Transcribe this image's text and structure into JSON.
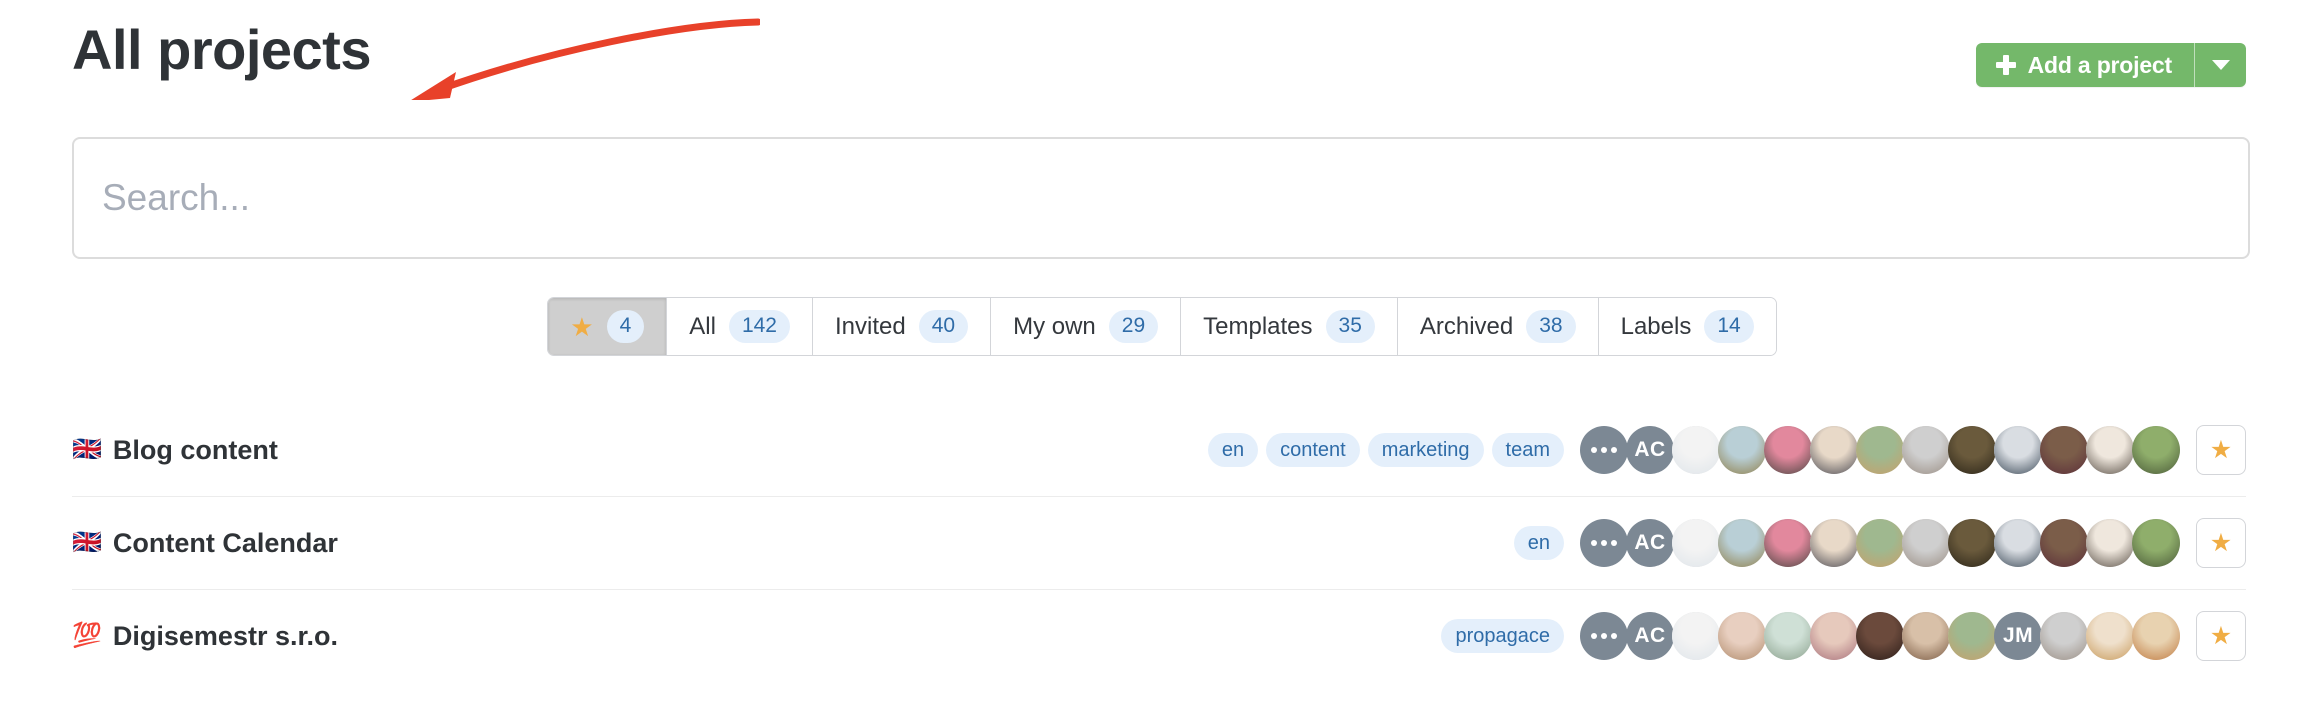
{
  "header": {
    "title": "All projects",
    "add_project_label": "Add a project"
  },
  "search": {
    "placeholder": "Search...",
    "value": ""
  },
  "tabs": [
    {
      "label": "",
      "icon": "star-icon",
      "count": "4",
      "active": true
    },
    {
      "label": "All",
      "count": "142",
      "active": false
    },
    {
      "label": "Invited",
      "count": "40",
      "active": false
    },
    {
      "label": "My own",
      "count": "29",
      "active": false
    },
    {
      "label": "Templates",
      "count": "35",
      "active": false
    },
    {
      "label": "Archived",
      "count": "38",
      "active": false
    },
    {
      "label": "Labels",
      "count": "14",
      "active": false
    }
  ],
  "projects": [
    {
      "emoji": "🇬🇧",
      "name": "Blog content",
      "tags": [
        "en",
        "content",
        "marketing",
        "team"
      ],
      "avatars": [
        {
          "type": "dots"
        },
        {
          "type": "initials",
          "text": "AC"
        },
        {
          "type": "photo",
          "color1": "#f3f3f3",
          "color2": "#dfe5ea"
        },
        {
          "type": "photo",
          "color1": "#b9cfd6",
          "color2": "#8f7f4a"
        },
        {
          "type": "photo",
          "color1": "#e2889d",
          "color2": "#4a4440"
        },
        {
          "type": "photo",
          "color1": "#e8d9c8",
          "color2": "#4b4a52"
        },
        {
          "type": "photo",
          "color1": "#9fb88f",
          "color2": "#c8a06a"
        },
        {
          "type": "photo",
          "color1": "#cfcfcf",
          "color2": "#9a8e84"
        },
        {
          "type": "photo",
          "color1": "#6a5a3c",
          "color2": "#2a2418"
        },
        {
          "type": "photo",
          "color1": "#d9dde2",
          "color2": "#3c4a58"
        },
        {
          "type": "photo",
          "color1": "#7b5d49",
          "color2": "#5b2e39"
        },
        {
          "type": "photo",
          "color1": "#efe7dd",
          "color2": "#5a5148"
        },
        {
          "type": "photo",
          "color1": "#8fae6b",
          "color2": "#4a5a38"
        }
      ],
      "starred": true
    },
    {
      "emoji": "🇬🇧",
      "name": "Content Calendar",
      "tags": [
        "en"
      ],
      "avatars": [
        {
          "type": "dots"
        },
        {
          "type": "initials",
          "text": "AC"
        },
        {
          "type": "photo",
          "color1": "#f3f3f3",
          "color2": "#dfe5ea"
        },
        {
          "type": "photo",
          "color1": "#b9cfd6",
          "color2": "#8f7f4a"
        },
        {
          "type": "photo",
          "color1": "#e2889d",
          "color2": "#4a4440"
        },
        {
          "type": "photo",
          "color1": "#e8d9c8",
          "color2": "#4b4a52"
        },
        {
          "type": "photo",
          "color1": "#9fb88f",
          "color2": "#c8a06a"
        },
        {
          "type": "photo",
          "color1": "#cfcfcf",
          "color2": "#9a8e84"
        },
        {
          "type": "photo",
          "color1": "#6a5a3c",
          "color2": "#2a2418"
        },
        {
          "type": "photo",
          "color1": "#d9dde2",
          "color2": "#3c4a58"
        },
        {
          "type": "photo",
          "color1": "#7b5d49",
          "color2": "#5b2e39"
        },
        {
          "type": "photo",
          "color1": "#efe7dd",
          "color2": "#5a5148"
        },
        {
          "type": "photo",
          "color1": "#8fae6b",
          "color2": "#4a5a38"
        }
      ],
      "starred": true
    },
    {
      "emoji": "💯",
      "name": "Digisemestr s.r.o.",
      "tags": [
        "propagace"
      ],
      "avatars": [
        {
          "type": "dots"
        },
        {
          "type": "initials",
          "text": "AC"
        },
        {
          "type": "photo",
          "color1": "#f3f3f3",
          "color2": "#dfe5ea"
        },
        {
          "type": "photo",
          "color1": "#e8cfc0",
          "color2": "#b08a6a"
        },
        {
          "type": "photo",
          "color1": "#cfe0d6",
          "color2": "#8aa08c"
        },
        {
          "type": "photo",
          "color1": "#e6c9bc",
          "color2": "#a8707a"
        },
        {
          "type": "photo",
          "color1": "#6b4a3c",
          "color2": "#2a1c18"
        },
        {
          "type": "photo",
          "color1": "#d8c0a8",
          "color2": "#7a5a42"
        },
        {
          "type": "photo",
          "color1": "#9fb88f",
          "color2": "#c8a06a"
        },
        {
          "type": "initials",
          "text": "JM"
        },
        {
          "type": "photo",
          "color1": "#cfcfcf",
          "color2": "#9a8e84"
        },
        {
          "type": "photo",
          "color1": "#efe0cc",
          "color2": "#c89a5a"
        },
        {
          "type": "photo",
          "color1": "#e8d2b0",
          "color2": "#c07a40"
        }
      ],
      "starred": true
    }
  ],
  "colors": {
    "accent_green": "#74b86a",
    "tag_bg": "#e4effb",
    "tag_text": "#2f6ca8",
    "star": "#f0ad44",
    "annotation_arrow": "#e8412a"
  }
}
